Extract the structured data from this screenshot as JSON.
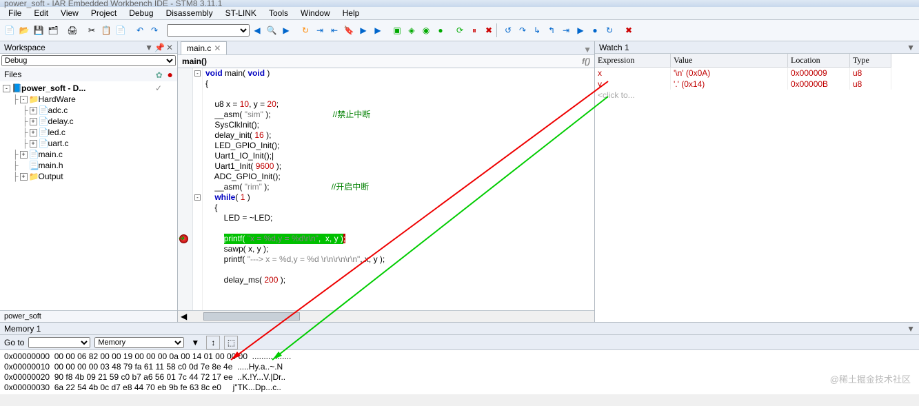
{
  "title": "power_soft - IAR Embedded Workbench IDE - STM8 3.11.1",
  "menu": [
    "File",
    "Edit",
    "View",
    "Project",
    "Debug",
    "Disassembly",
    "ST-LINK",
    "Tools",
    "Window",
    "Help"
  ],
  "workspace": {
    "title": "Workspace",
    "config": "Debug",
    "files_label": "Files",
    "tree": [
      {
        "ind": 0,
        "exp": "-",
        "ico": "📘",
        "txt": "power_soft - D...",
        "bold": true,
        "check": "✓"
      },
      {
        "ind": 1,
        "exp": "-",
        "ico": "📁",
        "txt": "HardWare"
      },
      {
        "ind": 2,
        "exp": "+",
        "ico": "📄",
        "txt": "adc.c",
        "c": true
      },
      {
        "ind": 2,
        "exp": "+",
        "ico": "📄",
        "txt": "delay.c",
        "c": true
      },
      {
        "ind": 2,
        "exp": "+",
        "ico": "📄",
        "txt": "led.c",
        "c": true
      },
      {
        "ind": 2,
        "exp": "+",
        "ico": "📄",
        "txt": "uart.c",
        "c": true
      },
      {
        "ind": 1,
        "exp": "+",
        "ico": "📄",
        "txt": "main.c",
        "c": true
      },
      {
        "ind": 1,
        "exp": "",
        "ico": "📄",
        "txt": "main.h",
        "h": true
      },
      {
        "ind": 1,
        "exp": "+",
        "ico": "📁",
        "txt": "Output"
      }
    ],
    "tab": "power_soft"
  },
  "editor": {
    "tab": "main.c",
    "scope": "main()",
    "code": [
      {
        "t": "<kw>void</kw> main( <kw>void</kw> )",
        "fold": "-"
      },
      {
        "t": "{"
      },
      {
        "t": ""
      },
      {
        "t": "    u8 x = <num>10</num>, y = <num>20</num>;"
      },
      {
        "t": "    __asm( <str>\"sim\"</str> );                           <cmt>//禁止中断</cmt>"
      },
      {
        "t": "    SysClkInit();"
      },
      {
        "t": "    delay_init( <num>16</num> );"
      },
      {
        "t": "    LED_GPIO_Init();"
      },
      {
        "t": "    Uart1_IO_Init();|"
      },
      {
        "t": "    Uart1_Init( <num>9600</num> );"
      },
      {
        "t": "    ADC_GPIO_Init();"
      },
      {
        "t": "    __asm( <str>\"rim\"</str> );                           <cmt>//开启中断</cmt>"
      },
      {
        "t": "    <kw>while</kw>( <num>1</num> )",
        "fold": "-"
      },
      {
        "t": "    {",
        "fold": ""
      },
      {
        "t": "        LED = ~LED;"
      },
      {
        "t": ""
      },
      {
        "t": "        <span class='hl-line'>printf( <str>\"x = %d,y = %d\\r\\n\"</str>,  x, y )</span><span class='hl-end'>;</span>",
        "bp": true
      },
      {
        "t": "        sawp( x, y );"
      },
      {
        "t": "        printf( <str>\"---> x = %d,y = %d \\r\\n\\r\\n\\r\\n\"</str>, x, y );"
      },
      {
        "t": ""
      },
      {
        "t": "        delay_ms( <num>200</num> );"
      }
    ]
  },
  "watch": {
    "title": "Watch 1",
    "cols": [
      "Expression",
      "Value",
      "Location",
      "Type"
    ],
    "rows": [
      {
        "e": "x",
        "v": "'\\n' (0x0A)",
        "l": "0x000009",
        "t": "u8"
      },
      {
        "e": "y",
        "v": "'.' (0x14)",
        "l": "0x00000B",
        "t": "u8"
      }
    ],
    "hint": "<click to..."
  },
  "memory": {
    "title": "Memory 1",
    "goto": "Go to",
    "zone": "Memory",
    "lines": [
      "0x00000000  00 00 06 82 00 00 19 00 00 00 0a 00 14 01 00 00 00  .................",
      "0x00000010  00 00 00 00 03 48 79 fa 61 11 58 c0 0d 7e 8e 4e  .....Hy.a..~.N",
      "0x00000020  90 f8 4b 09 21 59 c0 b7 a6 56 01 7c 44 72 17 ee  ..K.!Y...V.|Dr..",
      "0x00000030  6a 22 54 4b 0c d7 e8 44 70 eb 9b fe 63 8c e0     j\"TK...Dp...c.."
    ]
  },
  "watermark": "@稀土掘金技术社区"
}
